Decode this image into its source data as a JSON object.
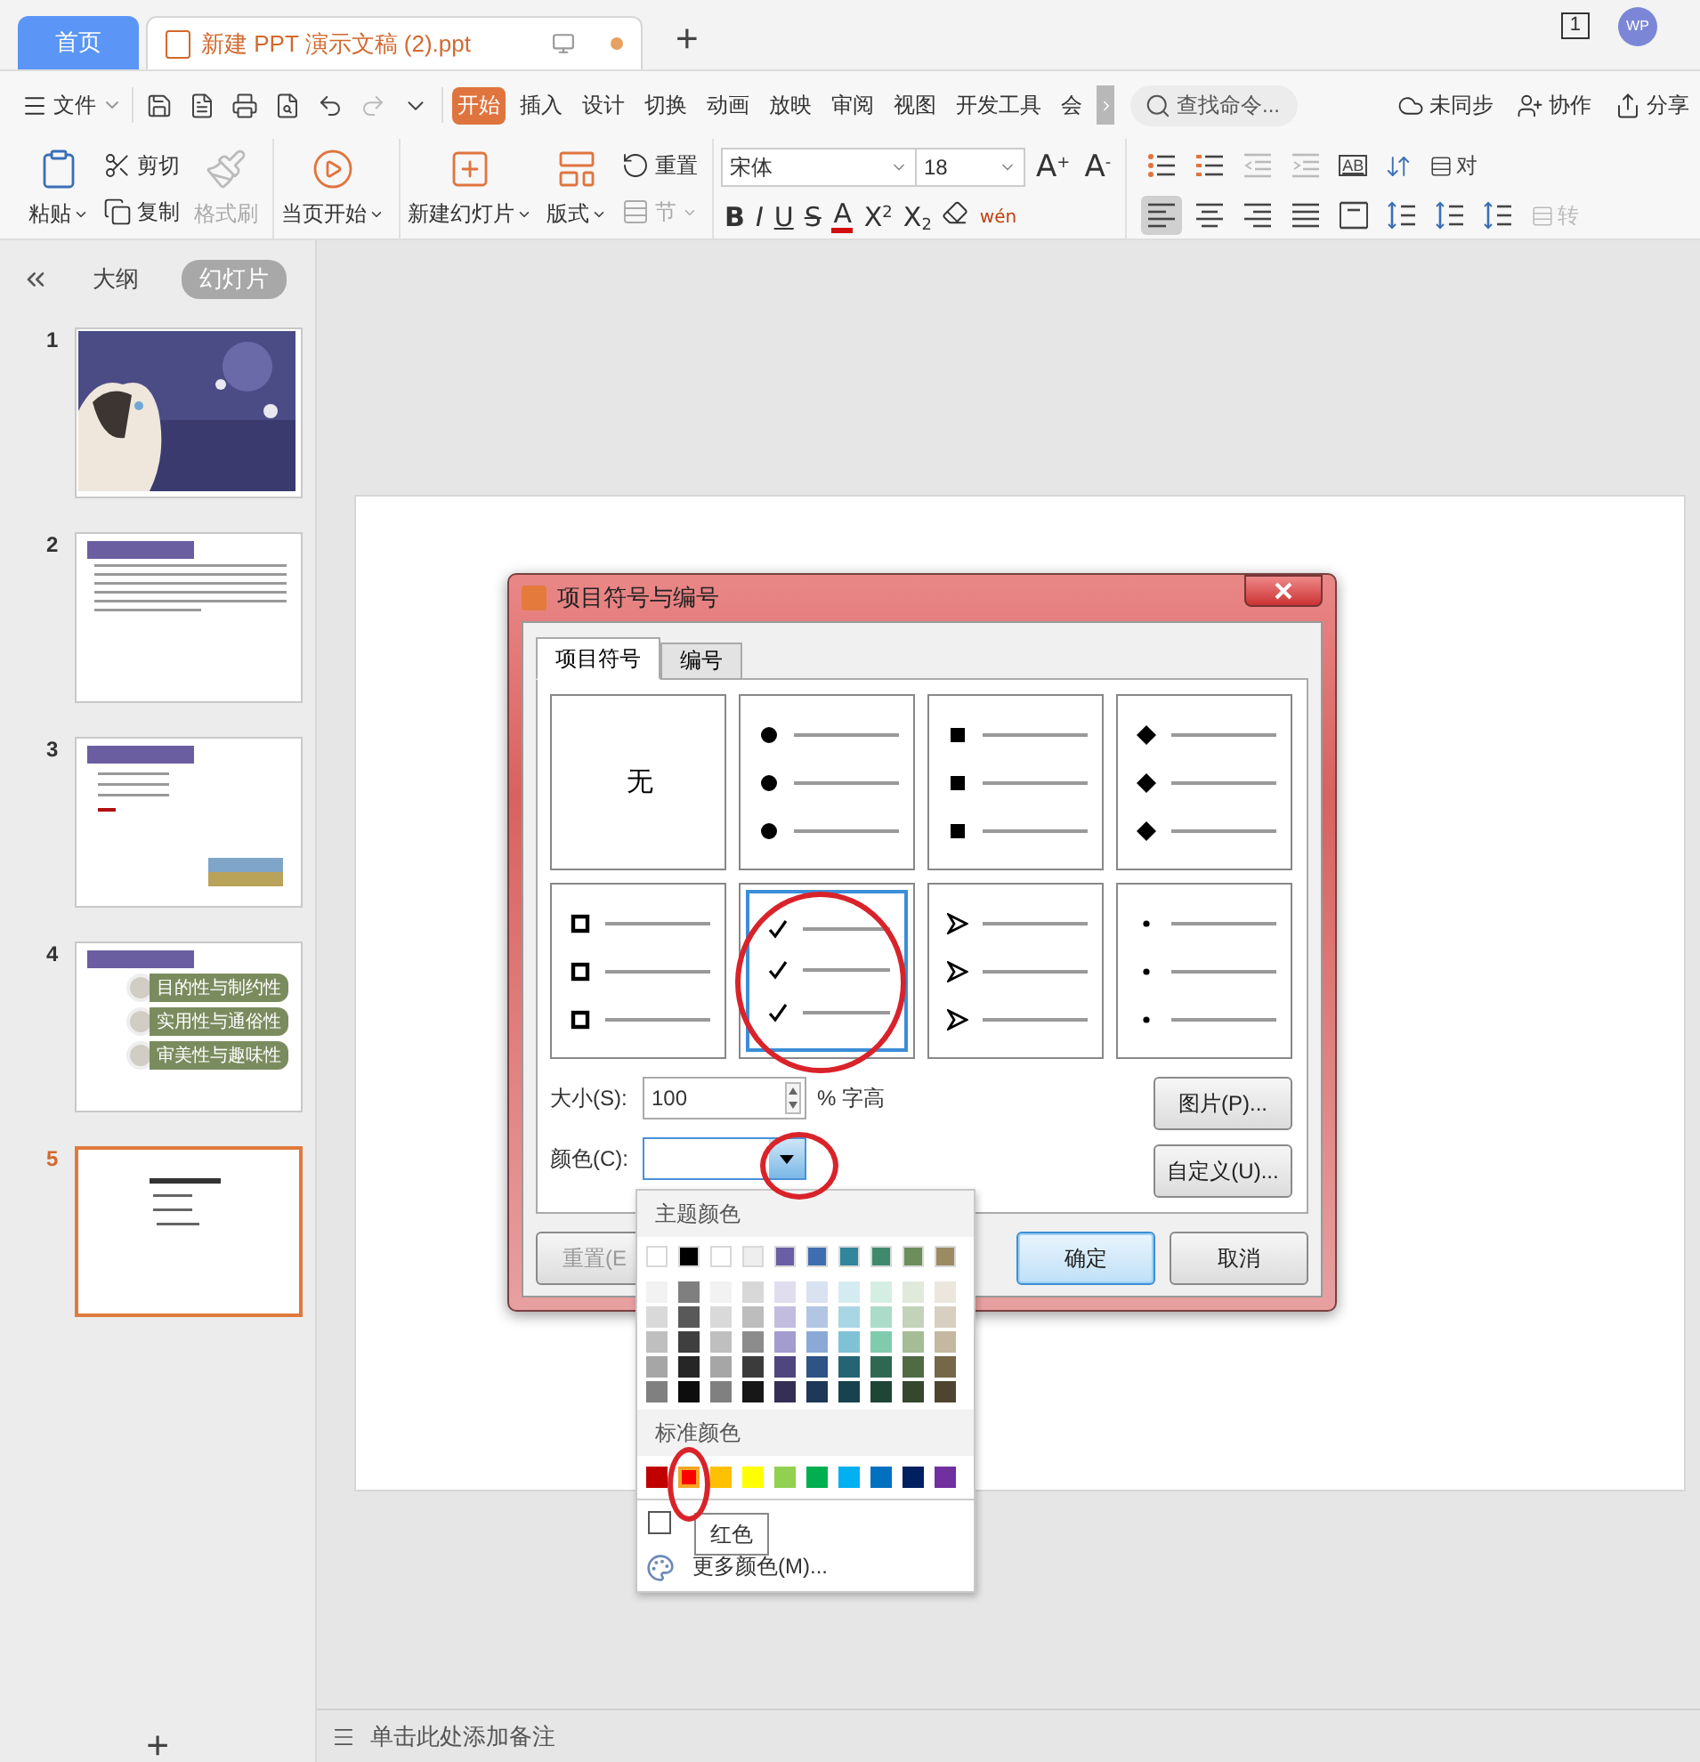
{
  "tabs": [
    {
      "kind": "home",
      "label": "首页",
      "selected": false,
      "unsaved": false
    },
    {
      "kind": "document",
      "label": "新建 PPT 演示文稿 (2).ppt",
      "selected": true,
      "unsaved": true
    }
  ],
  "new_tab": "+",
  "title_bar": {
    "page_count": "1",
    "avatar": "WP"
  },
  "menu": {
    "file": "文件",
    "quick_access": [
      {
        "kind": "save",
        "disabled": false
      },
      {
        "kind": "export",
        "disabled": false
      },
      {
        "kind": "print",
        "disabled": false
      },
      {
        "kind": "preview",
        "disabled": false
      },
      {
        "kind": "undo",
        "disabled": false
      },
      {
        "kind": "redo",
        "disabled": true
      },
      {
        "kind": "more",
        "disabled": false
      }
    ],
    "ribbon_tabs": [
      {
        "label": "开始",
        "selected": true
      },
      {
        "label": "插入",
        "selected": false
      },
      {
        "label": "设计",
        "selected": false
      },
      {
        "label": "切换",
        "selected": false
      },
      {
        "label": "动画",
        "selected": false
      },
      {
        "label": "放映",
        "selected": false
      },
      {
        "label": "审阅",
        "selected": false
      },
      {
        "label": "视图",
        "selected": false
      },
      {
        "label": "开发工具",
        "selected": false
      },
      {
        "label": "会",
        "selected": false
      }
    ],
    "search_placeholder": "查找命令...",
    "actions": [
      {
        "kind": "sync",
        "label": "未同步"
      },
      {
        "kind": "collab",
        "label": "协作"
      },
      {
        "kind": "share",
        "label": "分享"
      }
    ]
  },
  "ribbon_groups": [
    {
      "columns": [
        [
          {
            "kind": "paste",
            "label": "粘贴",
            "dropdown": true,
            "disabled": false
          }
        ],
        [
          {
            "kind": "cut",
            "label": "剪切",
            "dropdown": false,
            "disabled": false
          },
          {
            "kind": "copy",
            "label": "复制",
            "dropdown": false,
            "disabled": false
          }
        ],
        [
          {
            "kind": "format-painter",
            "label": "格式刷",
            "dropdown": false,
            "disabled": true
          }
        ]
      ]
    },
    {
      "columns": [
        [
          {
            "kind": "play",
            "label": "当页开始",
            "dropdown": true,
            "disabled": false
          }
        ]
      ]
    },
    {
      "columns": [
        [
          {
            "kind": "new-slide",
            "label": "新建幻灯片",
            "dropdown": true,
            "disabled": false
          }
        ],
        [
          {
            "kind": "layout",
            "label": "版式",
            "dropdown": true,
            "disabled": false
          }
        ],
        [
          {
            "kind": "reset",
            "label": "重置",
            "dropdown": false,
            "disabled": false
          },
          {
            "kind": "section",
            "label": "节",
            "dropdown": true,
            "disabled": true
          }
        ]
      ]
    }
  ],
  "font": {
    "name": "宋体",
    "size": "18",
    "grow": "A$^{+}$",
    "shrink": "A$^{-}$",
    "buttons": [
      {
        "kind": "bold",
        "label": "B"
      },
      {
        "kind": "italic",
        "label": "I"
      },
      {
        "kind": "underline",
        "label": "U"
      },
      {
        "kind": "strike",
        "label": "S"
      },
      {
        "kind": "font-color",
        "label": "A"
      },
      {
        "kind": "superscript",
        "label": "X$^{2}$"
      },
      {
        "kind": "subscript",
        "label": "X$_{2}$"
      },
      {
        "kind": "clear"
      },
      {
        "kind": "phonetic",
        "label": "wén"
      }
    ]
  },
  "paragraph": {
    "row1": [
      {
        "kind": "bullets",
        "selected": false,
        "disabled": false
      },
      {
        "kind": "numbering",
        "selected": false,
        "disabled": false
      },
      {
        "kind": "outdent",
        "selected": false,
        "disabled": true
      },
      {
        "kind": "indent",
        "selected": false,
        "disabled": true
      },
      {
        "kind": "text-direction",
        "label": "AB",
        "selected": false,
        "disabled": false
      },
      {
        "kind": "sort",
        "selected": false,
        "disabled": false
      },
      {
        "kind": "align-text",
        "label": "对",
        "selected": false,
        "disabled": false
      }
    ],
    "row2": [
      {
        "kind": "align-left",
        "selected": true,
        "disabled": false
      },
      {
        "kind": "align-center",
        "selected": false,
        "disabled": false
      },
      {
        "kind": "align-right",
        "selected": false,
        "disabled": false
      },
      {
        "kind": "justify",
        "selected": false,
        "disabled": false
      },
      {
        "kind": "distribute",
        "selected": false,
        "disabled": false
      },
      {
        "kind": "line-spacing",
        "selected": false,
        "disabled": false
      },
      {
        "kind": "space-before",
        "selected": false,
        "disabled": false
      },
      {
        "kind": "space-after",
        "selected": false,
        "disabled": false
      },
      {
        "kind": "convert",
        "label": "转",
        "selected": false,
        "disabled": true
      }
    ]
  },
  "sidebar": {
    "tabs": [
      {
        "label": "大纲",
        "selected": false
      },
      {
        "label": "幻灯片",
        "selected": true
      }
    ],
    "slides": [
      {
        "number": "1",
        "kind": "cover",
        "selected": false
      },
      {
        "number": "2",
        "kind": "text",
        "selected": false
      },
      {
        "number": "3",
        "kind": "list",
        "selected": false
      },
      {
        "number": "4",
        "kind": "diagram",
        "selected": false,
        "items": [
          "目的性与制约性",
          "实用性与通俗性",
          "审美性与趣味性"
        ]
      },
      {
        "number": "5",
        "kind": "title-list",
        "selected": true
      }
    ],
    "add": "+"
  },
  "notes_placeholder": "单击此处添加备注",
  "dialog": {
    "title": "项目符号与编号",
    "tabs": [
      {
        "label": "项目符号",
        "selected": true
      },
      {
        "label": "编号",
        "selected": false
      }
    ],
    "bullets": [
      {
        "kind": "none",
        "label": "无",
        "selected": false
      },
      {
        "kind": "dot",
        "selected": false
      },
      {
        "kind": "square",
        "selected": false
      },
      {
        "kind": "diamond",
        "selected": false
      },
      {
        "kind": "hollow-square",
        "selected": false
      },
      {
        "kind": "check",
        "selected": true
      },
      {
        "kind": "arrow",
        "selected": false
      },
      {
        "kind": "small-dot",
        "selected": false
      }
    ],
    "size": {
      "label": "大小(S):",
      "value": "100",
      "unit": "% 字高"
    },
    "color": {
      "label": "颜色(C):"
    },
    "side_buttons": [
      "图片(P)...",
      "自定义(U)..."
    ],
    "buttons": [
      {
        "kind": "reset",
        "label": "重置(E",
        "disabled": true,
        "default": false
      },
      {
        "kind": "ok",
        "label": "确定",
        "disabled": false,
        "default": true
      },
      {
        "kind": "cancel",
        "label": "取消",
        "disabled": false,
        "default": false
      }
    ]
  },
  "color_picker": {
    "theme_title": "主题颜色",
    "theme": [
      {
        "color": "#ffffff",
        "shades": [
          {
            "color": "#f2f2f2"
          },
          {
            "color": "#d9d9d9"
          },
          {
            "color": "#bfbfbf"
          },
          {
            "color": "#a6a6a6"
          },
          {
            "color": "#808080"
          }
        ]
      },
      {
        "color": "#000000",
        "shades": [
          {
            "color": "#7f7f7f"
          },
          {
            "color": "#595959"
          },
          {
            "color": "#3f3f3f"
          },
          {
            "color": "#262626"
          },
          {
            "color": "#0d0d0d"
          }
        ]
      },
      {
        "color": "#ffffff",
        "shades": [
          {
            "color": "#f2f2f2"
          },
          {
            "color": "#d9d9d9"
          },
          {
            "color": "#bfbfbf"
          },
          {
            "color": "#a6a6a6"
          },
          {
            "color": "#808080"
          }
        ]
      },
      {
        "color": "#eeeeee",
        "shades": [
          {
            "color": "#d8d8d8"
          },
          {
            "color": "#bdbdbd"
          },
          {
            "color": "#8c8c8c"
          },
          {
            "color": "#3b3b3b"
          },
          {
            "color": "#171717"
          }
        ]
      },
      {
        "color": "#6a5ea5",
        "shades": [
          {
            "color": "#e0ddef"
          },
          {
            "color": "#c2bddf"
          },
          {
            "color": "#a39ccf"
          },
          {
            "color": "#4f4680"
          },
          {
            "color": "#352f55"
          }
        ]
      },
      {
        "color": "#3e6eb0",
        "shades": [
          {
            "color": "#d8e2f1"
          },
          {
            "color": "#b2c6e4"
          },
          {
            "color": "#8ba9d6"
          },
          {
            "color": "#2e5385"
          },
          {
            "color": "#1f3758"
          }
        ]
      },
      {
        "color": "#31859c",
        "shades": [
          {
            "color": "#d4ebf1"
          },
          {
            "color": "#a9d6e3"
          },
          {
            "color": "#7fc2d5"
          },
          {
            "color": "#256475"
          },
          {
            "color": "#18424e"
          }
        ]
      },
      {
        "color": "#3f8a6e",
        "shades": [
          {
            "color": "#d5eee4"
          },
          {
            "color": "#aadcc9"
          },
          {
            "color": "#80cbae"
          },
          {
            "color": "#2f6852"
          },
          {
            "color": "#1f4537"
          }
        ]
      },
      {
        "color": "#6b8e5a",
        "shades": [
          {
            "color": "#e1e9dc"
          },
          {
            "color": "#c3d3b9"
          },
          {
            "color": "#a5bd97"
          },
          {
            "color": "#506a43"
          },
          {
            "color": "#35472d"
          }
        ]
      },
      {
        "color": "#9c8a62",
        "shades": [
          {
            "color": "#ebe7df"
          },
          {
            "color": "#d7cfc0"
          },
          {
            "color": "#c4b8a0"
          },
          {
            "color": "#756849"
          },
          {
            "color": "#4e4531"
          }
        ]
      }
    ],
    "standard_title": "标准颜色",
    "standard": [
      {
        "color": "#c00000",
        "selected": false
      },
      {
        "color": "#ff0000",
        "selected": true
      },
      {
        "color": "#ffc000",
        "selected": false
      },
      {
        "color": "#ffff00",
        "selected": false
      },
      {
        "color": "#92d050",
        "selected": false
      },
      {
        "color": "#00b050",
        "selected": false
      },
      {
        "color": "#00b0f0",
        "selected": false
      },
      {
        "color": "#0070c0",
        "selected": false
      },
      {
        "color": "#002060",
        "selected": false
      },
      {
        "color": "#7030a0",
        "selected": false
      }
    ],
    "more": "更多颜色(M)...",
    "tooltip": "红色"
  },
  "annotations": [
    {
      "kind": "bullet-circle"
    },
    {
      "kind": "dropdown-circle"
    },
    {
      "kind": "swatch-circle"
    }
  ]
}
